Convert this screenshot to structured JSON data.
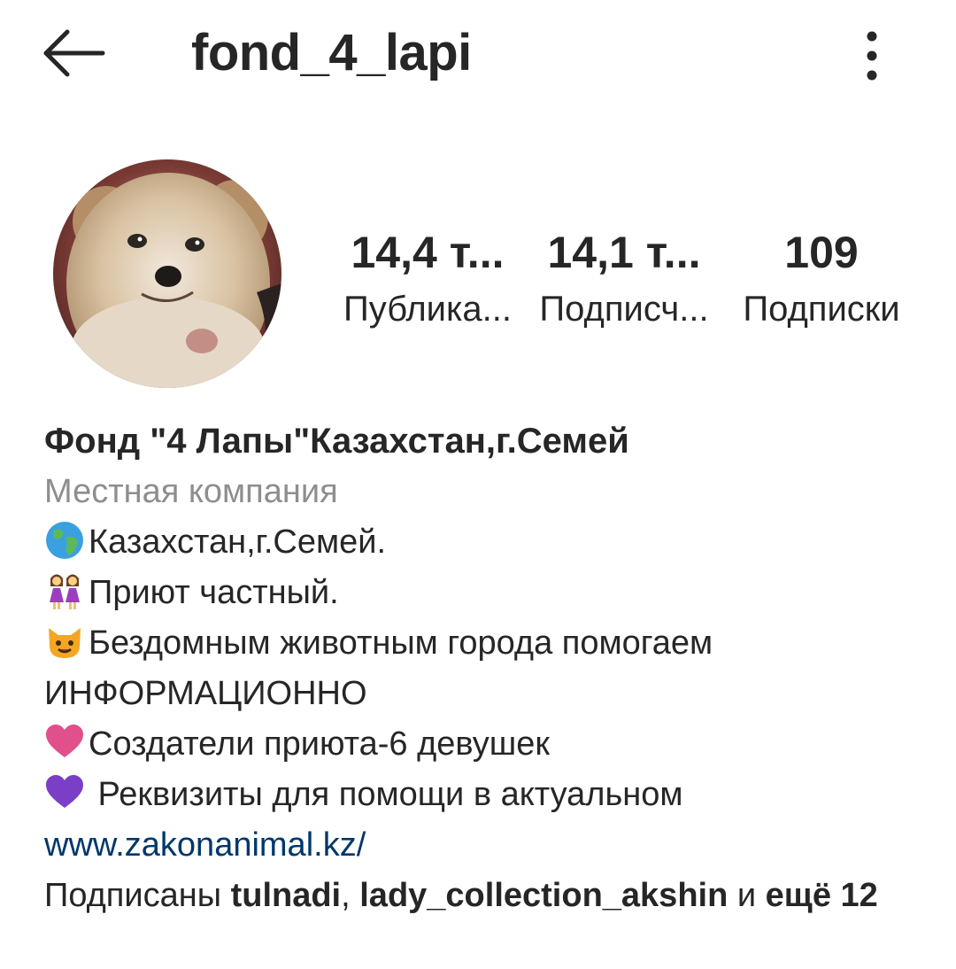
{
  "header": {
    "username": "fond_4_lapi",
    "back_icon": "arrow-left-icon",
    "more_icon": "more-vertical-icon"
  },
  "stats": {
    "posts_value": "14,4 т...",
    "posts_label": "Публика...",
    "followers_value": "14,1 т...",
    "followers_label": "Подписч...",
    "following_value": "109",
    "following_label": "Подписки"
  },
  "bio": {
    "name": "Фонд \"4 Лапы\"Казахстан,г.Семей",
    "category": "Местная компания",
    "lines": [
      {
        "icon": "globe-icon",
        "text": "Казахстан,г.Семей."
      },
      {
        "icon": "two-women-icon",
        "text": "Приют частный."
      },
      {
        "icon": "cat-face-icon",
        "text": "Бездомным животным города помогаем"
      },
      {
        "icon": "",
        "text": "ИНФОРМАЦИОННО"
      },
      {
        "icon": "pink-heart-icon",
        "text": "Создатели приюта-6 девушек"
      },
      {
        "icon": "purple-heart-icon",
        "text": " Реквизиты для помощи в актуальном"
      }
    ],
    "website": "www.zakonanimal.kz/"
  },
  "followed_by": {
    "prefix": "Подписаны ",
    "user1": "tulnadi",
    "sep": ", ",
    "user2": "lady_collection_akshin",
    "middle": " и ",
    "more": "ещё 12"
  },
  "colors": {
    "text": "#262626",
    "secondary": "#8e8e8e",
    "link": "#00376b",
    "background": "#ffffff"
  }
}
